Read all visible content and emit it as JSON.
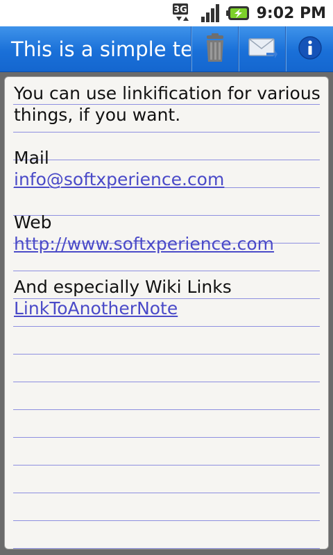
{
  "status_bar": {
    "network_label": "3G",
    "time": "9:02 PM",
    "icons": [
      "3g-data-icon",
      "signal-strength-icon",
      "battery-charging-icon"
    ]
  },
  "action_bar": {
    "title": "This is a simple te",
    "buttons": [
      {
        "name": "delete",
        "icon": "trash-icon"
      },
      {
        "name": "send",
        "icon": "mail-icon"
      },
      {
        "name": "info",
        "icon": "info-icon"
      }
    ],
    "colors": {
      "bar": "#1a70d8",
      "text": "#ffffff"
    }
  },
  "note": {
    "lines": [
      {
        "text": "You can use linkification for various",
        "link": false
      },
      {
        "text": "things, if you want.",
        "link": false
      },
      {
        "text": "",
        "link": false
      },
      {
        "text": "Mail",
        "link": false
      },
      {
        "text": "info@softxperience.com",
        "link": true
      },
      {
        "text": "",
        "link": false
      },
      {
        "text": "Web",
        "link": false
      },
      {
        "text": "http://www.softxperience.com",
        "link": true
      },
      {
        "text": "",
        "link": false
      },
      {
        "text": "And especially Wiki Links",
        "link": false
      },
      {
        "text": "LinkToAnotherNote",
        "link": true
      }
    ],
    "colors": {
      "paper": "#f6f5f2",
      "rule_line": "#8d8fe0",
      "link": "#4a4ac8"
    }
  }
}
